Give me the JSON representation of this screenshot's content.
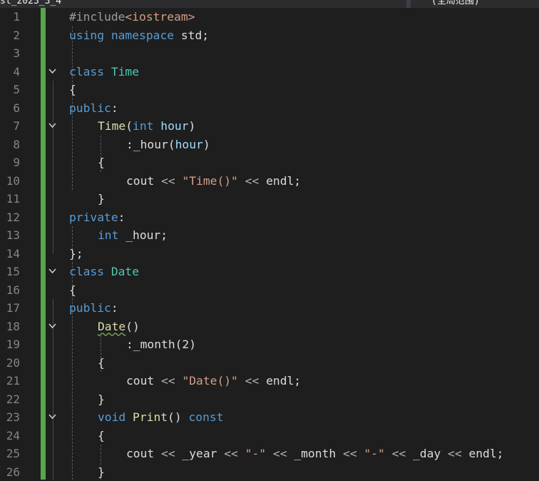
{
  "window": {
    "tab_left": "st_2023_3_4",
    "tab_right": "(全局范围)"
  },
  "editor": {
    "lines": [
      {
        "n": "1",
        "tokens": [
          [
            "pp",
            "#include"
          ],
          [
            "str",
            "<iostream>"
          ]
        ]
      },
      {
        "n": "2",
        "tokens": [
          [
            "kw",
            "using"
          ],
          [
            "",
            " "
          ],
          [
            "kw",
            "namespace"
          ],
          [
            "",
            " std;"
          ]
        ]
      },
      {
        "n": "3",
        "tokens": []
      },
      {
        "n": "4",
        "fold": true,
        "tokens": [
          [
            "kw",
            "class"
          ],
          [
            "",
            " "
          ],
          [
            "cls",
            "Time"
          ]
        ]
      },
      {
        "n": "5",
        "tokens": [
          [
            "",
            "{"
          ]
        ]
      },
      {
        "n": "6",
        "tokens": [
          [
            "kw",
            "public"
          ],
          [
            "",
            ":"
          ]
        ]
      },
      {
        "n": "7",
        "fold": true,
        "indent": 1,
        "tokens": [
          [
            "fn",
            "Time"
          ],
          [
            "",
            "("
          ],
          [
            "kw",
            "int"
          ],
          [
            "",
            " "
          ],
          [
            "par",
            "hour"
          ],
          [
            "",
            ")"
          ]
        ]
      },
      {
        "n": "8",
        "indent": 2,
        "tokens": [
          [
            "",
            ":_hour("
          ],
          [
            "par",
            "hour"
          ],
          [
            "",
            ")"
          ]
        ]
      },
      {
        "n": "9",
        "indent": 1,
        "tokens": [
          [
            "",
            "{"
          ]
        ]
      },
      {
        "n": "10",
        "indent": 2,
        "tokens": [
          [
            "",
            "cout "
          ],
          [
            "op",
            "<<"
          ],
          [
            "",
            " "
          ],
          [
            "str",
            "\"Time()\""
          ],
          [
            "",
            " "
          ],
          [
            "op",
            "<<"
          ],
          [
            "",
            " endl;"
          ]
        ]
      },
      {
        "n": "11",
        "indent": 1,
        "tokens": [
          [
            "",
            "}"
          ]
        ]
      },
      {
        "n": "12",
        "tokens": [
          [
            "kw",
            "private"
          ],
          [
            "",
            ":"
          ]
        ]
      },
      {
        "n": "13",
        "indent": 1,
        "tokens": [
          [
            "kw",
            "int"
          ],
          [
            "",
            " _hour;"
          ]
        ]
      },
      {
        "n": "14",
        "tokens": [
          [
            "",
            "};"
          ]
        ]
      },
      {
        "n": "15",
        "fold": true,
        "tokens": [
          [
            "kw",
            "class"
          ],
          [
            "",
            " "
          ],
          [
            "cls",
            "Date"
          ]
        ]
      },
      {
        "n": "16",
        "tokens": [
          [
            "",
            "{"
          ]
        ]
      },
      {
        "n": "17",
        "tokens": [
          [
            "kw",
            "public"
          ],
          [
            "",
            ":"
          ]
        ]
      },
      {
        "n": "18",
        "fold": true,
        "indent": 1,
        "tokens": [
          [
            "fn squig",
            "Date"
          ],
          [
            "",
            "()"
          ]
        ]
      },
      {
        "n": "19",
        "indent": 2,
        "tokens": [
          [
            "",
            ":_month(2)"
          ]
        ]
      },
      {
        "n": "20",
        "indent": 1,
        "tokens": [
          [
            "",
            "{"
          ]
        ]
      },
      {
        "n": "21",
        "indent": 2,
        "tokens": [
          [
            "",
            "cout "
          ],
          [
            "op",
            "<<"
          ],
          [
            "",
            " "
          ],
          [
            "str",
            "\"Date()\""
          ],
          [
            "",
            " "
          ],
          [
            "op",
            "<<"
          ],
          [
            "",
            " endl;"
          ]
        ]
      },
      {
        "n": "22",
        "indent": 1,
        "tokens": [
          [
            "",
            "}"
          ]
        ]
      },
      {
        "n": "23",
        "fold": true,
        "indent": 1,
        "tokens": [
          [
            "kw",
            "void"
          ],
          [
            "",
            " "
          ],
          [
            "fn",
            "Print"
          ],
          [
            "",
            "() "
          ],
          [
            "kw",
            "const"
          ]
        ]
      },
      {
        "n": "24",
        "indent": 1,
        "tokens": [
          [
            "",
            "{"
          ]
        ]
      },
      {
        "n": "25",
        "indent": 2,
        "tokens": [
          [
            "",
            "cout "
          ],
          [
            "op",
            "<<"
          ],
          [
            "",
            " _year "
          ],
          [
            "op",
            "<<"
          ],
          [
            "",
            " "
          ],
          [
            "str",
            "\"-\""
          ],
          [
            "",
            " "
          ],
          [
            "op",
            "<<"
          ],
          [
            "",
            " _month "
          ],
          [
            "op",
            "<<"
          ],
          [
            "",
            " "
          ],
          [
            "str",
            "\"-\""
          ],
          [
            "",
            " "
          ],
          [
            "op",
            "<<"
          ],
          [
            "",
            " _day "
          ],
          [
            "op",
            "<<"
          ],
          [
            "",
            " endl;"
          ]
        ]
      },
      {
        "n": "26",
        "indent": 1,
        "tokens": [
          [
            "",
            "}"
          ]
        ]
      }
    ]
  }
}
